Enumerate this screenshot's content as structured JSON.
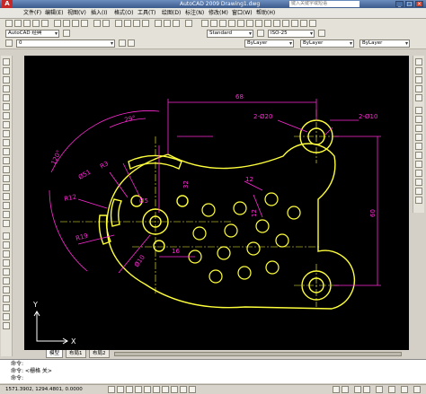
{
  "window": {
    "title": "AutoCAD 2009 Drawing1.dwg",
    "search_placeholder": "键入关键字或短语"
  },
  "menu": [
    "文件(F)",
    "编辑(E)",
    "视图(V)",
    "插入(I)",
    "格式(O)",
    "工具(T)",
    "绘图(D)",
    "标注(N)",
    "修改(M)",
    "窗口(W)",
    "帮助(H)"
  ],
  "toolbars": {
    "workspace": "AutoCAD 经典",
    "layer": "0",
    "color": "ByLayer",
    "linetype": "ByLayer",
    "lineweight": "ByLayer",
    "textstyle": "Standard",
    "dimstyle": "ISO-25"
  },
  "drawing": {
    "dimensions": [
      "68",
      "29°",
      "2-Ø20",
      "2-Ø10",
      "120°",
      "Ø51",
      "R3",
      "R12",
      "Ø5",
      "32",
      "12",
      "12",
      "60",
      "R19",
      "Ø10",
      "16"
    ]
  },
  "ucs": {
    "x": "X",
    "y": "Y"
  },
  "layout_tabs": [
    "模型",
    "布局1",
    "布局2"
  ],
  "command_line": [
    "命令:",
    "命令: <栅格 关>",
    "命令:"
  ],
  "status": {
    "coords": "1571.3902, 1294.4801, 0.0000"
  },
  "colors": {
    "dim": "#ff2bd6",
    "geometry": "#ffff3c",
    "canvas": "#000000"
  }
}
